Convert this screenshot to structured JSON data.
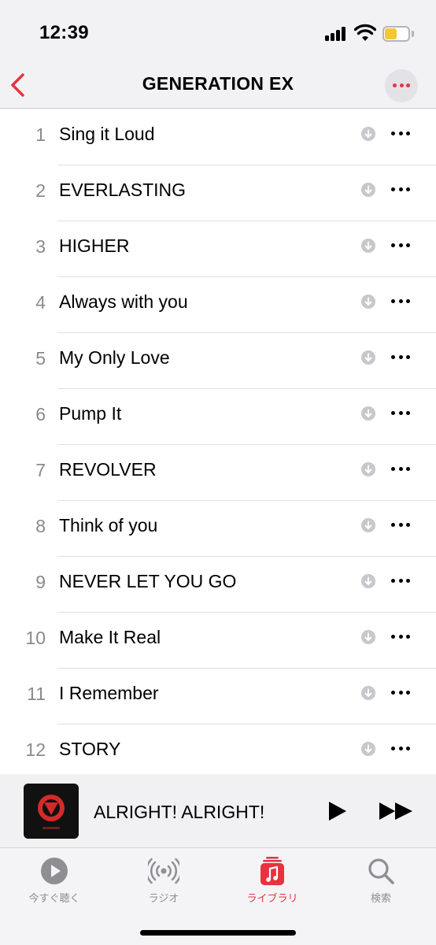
{
  "status_bar": {
    "time": "12:39"
  },
  "nav": {
    "title": "GENERATION EX"
  },
  "tracks": [
    {
      "number": "1",
      "title": "Sing it Loud"
    },
    {
      "number": "2",
      "title": "EVERLASTING"
    },
    {
      "number": "3",
      "title": "HIGHER"
    },
    {
      "number": "4",
      "title": "Always with you"
    },
    {
      "number": "5",
      "title": "My Only Love"
    },
    {
      "number": "6",
      "title": "Pump It"
    },
    {
      "number": "7",
      "title": "REVOLVER"
    },
    {
      "number": "8",
      "title": "Think of you"
    },
    {
      "number": "9",
      "title": "NEVER LET YOU GO"
    },
    {
      "number": "10",
      "title": "Make It Real"
    },
    {
      "number": "11",
      "title": "I Remember"
    },
    {
      "number": "12",
      "title": "STORY"
    }
  ],
  "mini_player": {
    "title": "ALRIGHT! ALRIGHT!"
  },
  "tabs": [
    {
      "label": "今すぐ聴く",
      "icon": "listen-now-icon",
      "active": false
    },
    {
      "label": "ラジオ",
      "icon": "radio-icon",
      "active": false
    },
    {
      "label": "ライブラリ",
      "icon": "library-icon",
      "active": true
    },
    {
      "label": "検索",
      "icon": "search-icon",
      "active": false
    }
  ],
  "colors": {
    "accent": "#e8323f",
    "battery": "#f4c733"
  }
}
